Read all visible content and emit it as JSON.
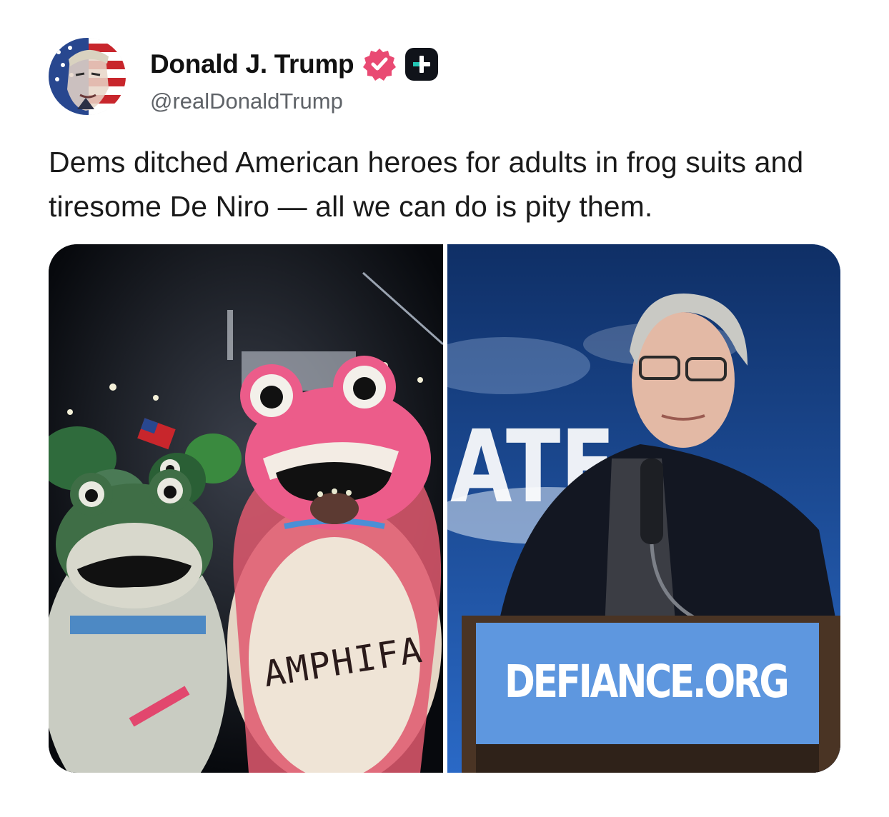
{
  "post": {
    "author_name": "Donald J. Trump",
    "handle": "@realDonaldTrump",
    "text": "Dems ditched American heroes for adults in frog suits and tiresome De Niro — all we can do is pity them."
  },
  "icons": {
    "avatar": "avatar-portrait",
    "verified": "verified-badge-icon",
    "plus": "plus-badge-icon"
  },
  "media": {
    "left_photo_text": "AMPHIFA",
    "right_photo_sign": "DEFIANCE.ORG",
    "right_photo_backdrop_text": "ATE"
  },
  "colors": {
    "verified": "#e94a73",
    "plus_badge_bg": "#10131a",
    "plus_badge_accent": "#23c6b4",
    "handle": "#5f6368"
  }
}
